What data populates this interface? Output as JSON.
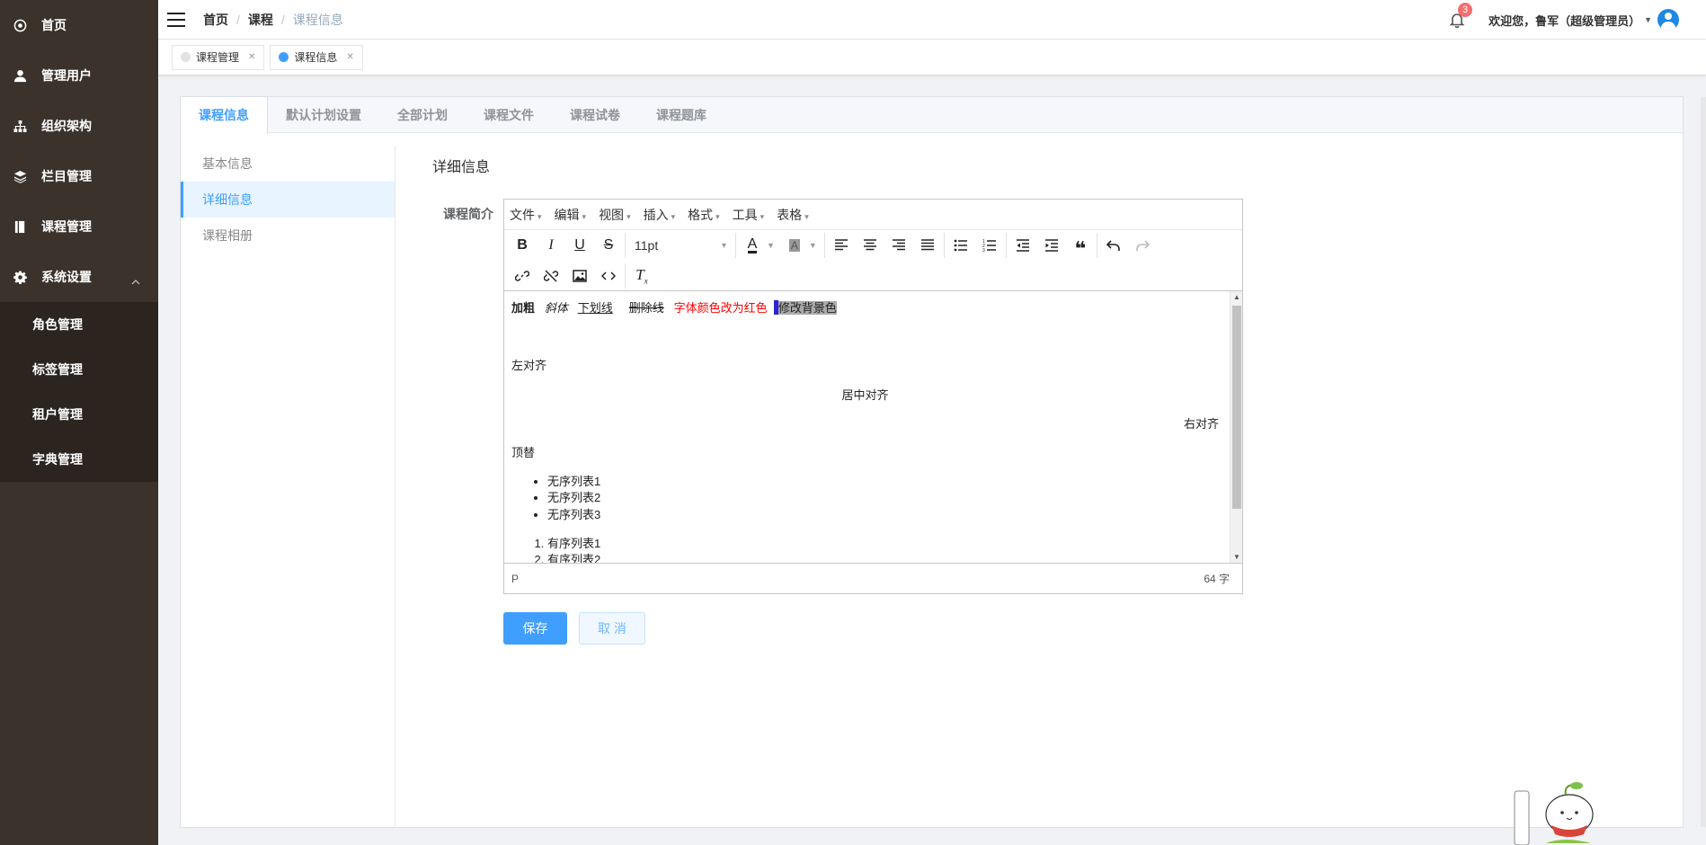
{
  "sidebar": {
    "items": [
      {
        "label": "首页",
        "icon": "dashboard-icon"
      },
      {
        "label": "管理用户",
        "icon": "user-icon"
      },
      {
        "label": "组织架构",
        "icon": "org-tree-icon"
      },
      {
        "label": "栏目管理",
        "icon": "layers-icon"
      },
      {
        "label": "课程管理",
        "icon": "book-icon"
      },
      {
        "label": "系统设置",
        "icon": "gear-icon"
      }
    ],
    "sub_items": [
      {
        "label": "角色管理"
      },
      {
        "label": "标签管理"
      },
      {
        "label": "租户管理"
      },
      {
        "label": "字典管理"
      }
    ]
  },
  "header": {
    "breadcrumb": [
      "首页",
      "课程",
      "课程信息"
    ],
    "notification_count": "3",
    "welcome": "欢迎您，鲁军（超级管理员）"
  },
  "tags": [
    {
      "label": "课程管理"
    },
    {
      "label": "课程信息"
    }
  ],
  "tabs": [
    "课程信息",
    "默认计划设置",
    "全部计划",
    "课程文件",
    "课程试卷",
    "课程题库"
  ],
  "left_menu": [
    "基本信息",
    "详细信息",
    "课程相册"
  ],
  "section_title": "详细信息",
  "form": {
    "label": "课程简介",
    "save": "保存",
    "cancel": "取 消"
  },
  "editor": {
    "menus": [
      "文件",
      "编辑",
      "视图",
      "插入",
      "格式",
      "工具",
      "表格"
    ],
    "font_size": "11pt",
    "content": {
      "bold": "加粗",
      "italic": "斜体",
      "underline": "下划线",
      "strike": "删除线",
      "red": "字体颜色改为红色",
      "bg": "修改背景色",
      "left": "左对齐",
      "center": "居中对齐",
      "right": "右对齐",
      "indent": "顶替",
      "ul": [
        "无序列表1",
        "无序列表2",
        "无序列表3"
      ],
      "ol": [
        "有序列表1",
        "有序列表2"
      ]
    },
    "status_path": "P",
    "word_count": "64 字"
  },
  "colors": {
    "sidebar_bg": "#3a322b",
    "accent": "#409eff",
    "red_text": "#f00"
  }
}
